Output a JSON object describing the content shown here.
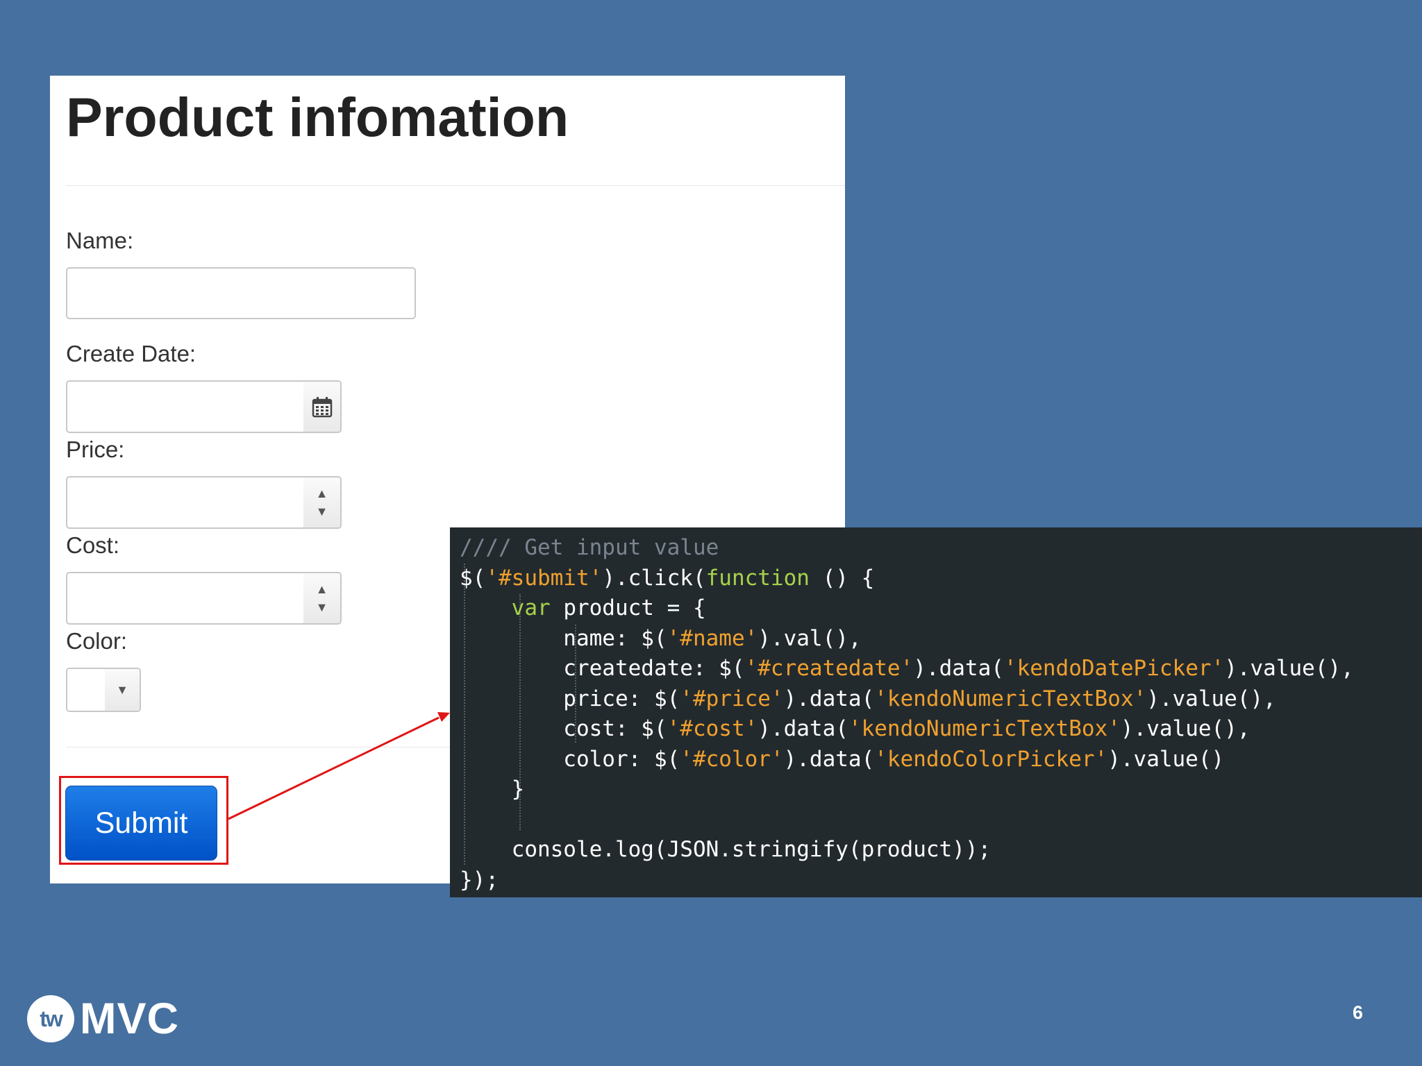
{
  "form": {
    "title": "Product infomation",
    "name_label": "Name:",
    "name_value": "",
    "createdate_label": "Create Date:",
    "createdate_value": "",
    "price_label": "Price:",
    "price_value": "",
    "cost_label": "Cost:",
    "cost_value": "",
    "color_label": "Color:",
    "color_value": "#ffffff",
    "submit_label": "Submit"
  },
  "code": {
    "lines": [
      [
        {
          "t": "//// Get input value",
          "c": "comment"
        }
      ],
      [
        {
          "t": "$("
        },
        {
          "t": "'#submit'",
          "c": "string"
        },
        {
          "t": ").click("
        },
        {
          "t": "function",
          "c": "keyword"
        },
        {
          "t": " () {"
        }
      ],
      [
        {
          "t": "    "
        },
        {
          "t": "var",
          "c": "keyword"
        },
        {
          "t": " product = {"
        }
      ],
      [
        {
          "t": "        name: $("
        },
        {
          "t": "'#name'",
          "c": "string"
        },
        {
          "t": ").val(),"
        }
      ],
      [
        {
          "t": "        createdate: $("
        },
        {
          "t": "'#createdate'",
          "c": "string"
        },
        {
          "t": ").data("
        },
        {
          "t": "'kendoDatePicker'",
          "c": "string"
        },
        {
          "t": ").value(),"
        }
      ],
      [
        {
          "t": "        price: $("
        },
        {
          "t": "'#price'",
          "c": "string"
        },
        {
          "t": ").data("
        },
        {
          "t": "'kendoNumericTextBox'",
          "c": "string"
        },
        {
          "t": ").value(),"
        }
      ],
      [
        {
          "t": "        cost: $("
        },
        {
          "t": "'#cost'",
          "c": "string"
        },
        {
          "t": ").data("
        },
        {
          "t": "'kendoNumericTextBox'",
          "c": "string"
        },
        {
          "t": ").value(),"
        }
      ],
      [
        {
          "t": "        color: $("
        },
        {
          "t": "'#color'",
          "c": "string"
        },
        {
          "t": ").data("
        },
        {
          "t": "'kendoColorPicker'",
          "c": "string"
        },
        {
          "t": ").value()"
        }
      ],
      [
        {
          "t": "    }"
        }
      ],
      [
        {
          "t": ""
        }
      ],
      [
        {
          "t": "    console.log(JSON.stringify(product));"
        }
      ],
      [
        {
          "t": "});"
        }
      ]
    ]
  },
  "footer": {
    "logo_mark": "tw",
    "logo_text": "MVC",
    "page_number": "6"
  },
  "colors": {
    "slide_background": "#46709f",
    "code_background": "#232a2e",
    "code_string": "#f0a12e",
    "code_keyword": "#a6d24a",
    "code_comment": "#7b8590",
    "highlight_red": "#e01515",
    "submit_blue": "#0058d0"
  },
  "icons": {
    "date_picker": "calendar-icon",
    "spinner": "spinner-arrows-icon",
    "color_dropdown": "chevron-down-icon"
  }
}
